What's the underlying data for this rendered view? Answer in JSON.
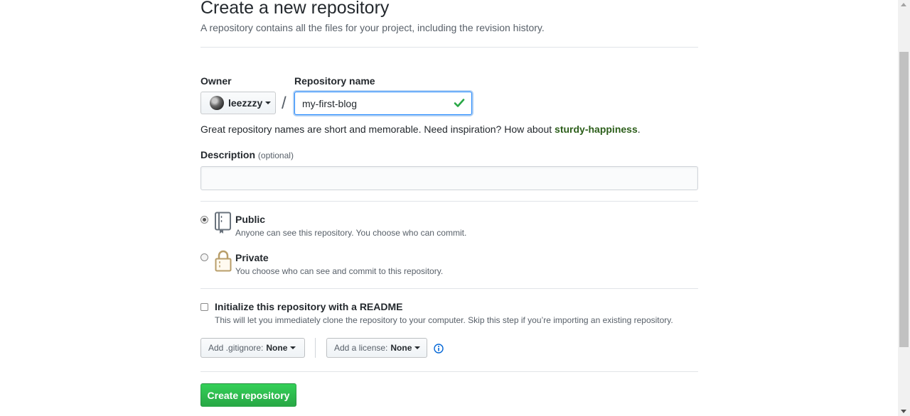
{
  "header": {
    "title": "Create a new repository",
    "subtitle": "A repository contains all the files for your project, including the revision history."
  },
  "owner": {
    "label": "Owner",
    "value": "leezzzy",
    "separator": "/"
  },
  "repo_name": {
    "label": "Repository name",
    "value": "my-first-blog",
    "valid_icon": "check-icon"
  },
  "hint": {
    "text": "Great repository names are short and memorable. Need inspiration? How about ",
    "suggestion": "sturdy-happiness",
    "end": "."
  },
  "description": {
    "label": "Description",
    "optional": "(optional)",
    "value": ""
  },
  "visibility": {
    "selected": "public",
    "public": {
      "title": "Public",
      "note": "Anyone can see this repository. You choose who can commit.",
      "icon": "repo-book-icon"
    },
    "private": {
      "title": "Private",
      "note": "You choose who can see and commit to this repository.",
      "icon": "lock-icon"
    }
  },
  "readme": {
    "checked": false,
    "title": "Initialize this repository with a README",
    "note": "This will let you immediately clone the repository to your computer. Skip this step if you’re importing an existing repository."
  },
  "gitignore": {
    "label": "Add .gitignore:",
    "value": "None"
  },
  "license": {
    "label": "Add a license:",
    "value": "None"
  },
  "info_icon": "info-icon",
  "submit": {
    "label": "Create repository"
  },
  "colors": {
    "accent_green": "#28a745",
    "focus_blue": "#2188ff",
    "suggestion": "#2c5e1a",
    "muted": "#586069"
  }
}
